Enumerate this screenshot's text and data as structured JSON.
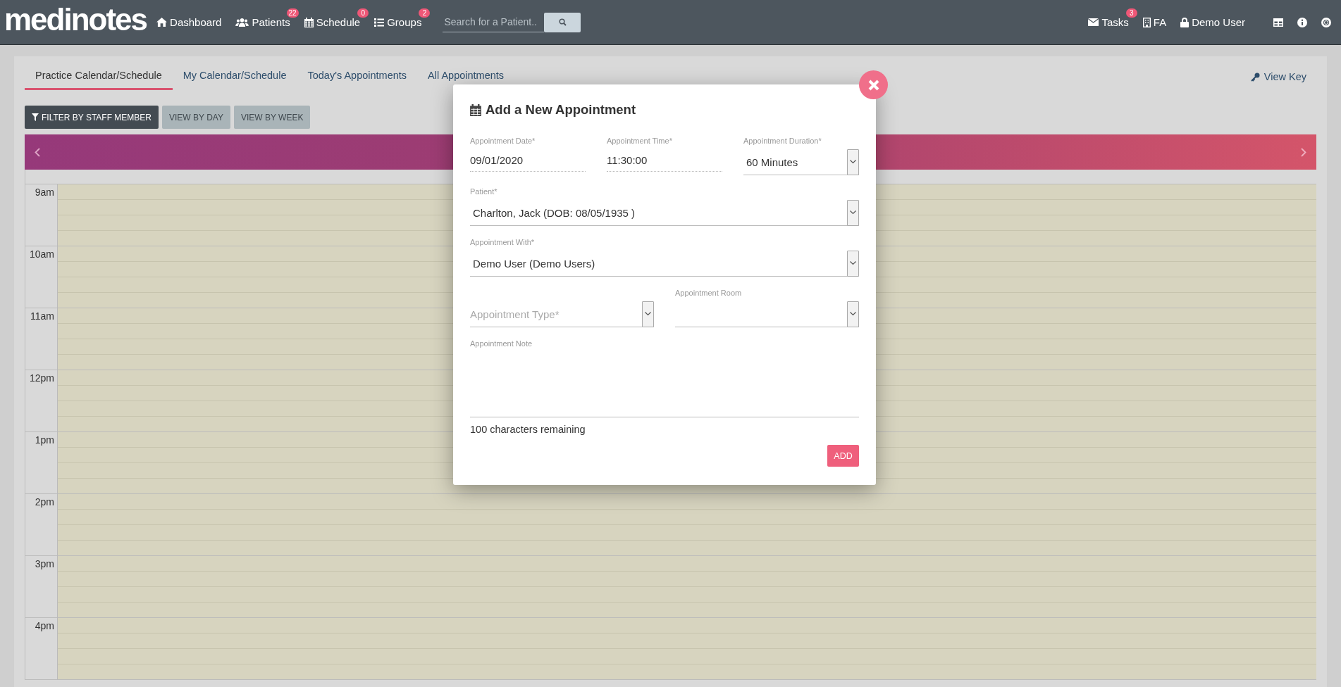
{
  "navbar": {
    "logo": "medinotes",
    "links": [
      {
        "label": "Dashboard"
      },
      {
        "label": "Patients",
        "badge": "22"
      },
      {
        "label": "Schedule",
        "badge": "0"
      },
      {
        "label": "Groups",
        "badge": "2"
      }
    ],
    "search": {
      "placeholder": "Search for a Patient.."
    },
    "right": [
      {
        "label": "Tasks",
        "badge": "3"
      },
      {
        "label": "FA"
      },
      {
        "label": "Demo User"
      }
    ]
  },
  "tabs": [
    {
      "label": "Practice Calendar/Schedule",
      "selected": true
    },
    {
      "label": "My Calendar/Schedule",
      "selected": false
    },
    {
      "label": "Today's Appointments",
      "selected": false
    },
    {
      "label": "All Appointments",
      "selected": false
    }
  ],
  "view_key": "View Key",
  "toolbar": [
    {
      "label": "FILTER BY STAFF MEMBER",
      "kind": "filter"
    },
    {
      "label": "VIEW BY DAY",
      "kind": "view"
    },
    {
      "label": "VIEW BY WEEK",
      "kind": "view"
    }
  ],
  "calendar": {
    "hours": [
      "9am",
      "10am",
      "11am",
      "12pm",
      "1pm",
      "2pm",
      "3pm",
      "4pm"
    ]
  },
  "modal": {
    "title": "Add a New Appointment",
    "rows": [
      [
        {
          "kind": "input",
          "label": "Appointment Date*",
          "value": "09/01/2020"
        },
        {
          "kind": "input",
          "label": "Appointment Time*",
          "value": "11:30:00"
        },
        {
          "kind": "select",
          "label": "Appointment Duration*",
          "value": "60 Minutes"
        }
      ],
      [
        {
          "kind": "select",
          "label": "Patient*",
          "value": "Charlton, Jack (DOB: 08/05/1935 )"
        }
      ],
      [
        {
          "kind": "select",
          "label": "Appointment With*",
          "value": "Demo User (Demo Users)"
        }
      ],
      [
        {
          "kind": "select",
          "placeholder": "Appointment Type*"
        },
        {
          "kind": "select",
          "label": "Appointment Room"
        }
      ],
      [
        {
          "kind": "textarea",
          "label": "Appointment Note"
        }
      ]
    ],
    "counter": "100 characters remaining",
    "submit": "ADD"
  }
}
